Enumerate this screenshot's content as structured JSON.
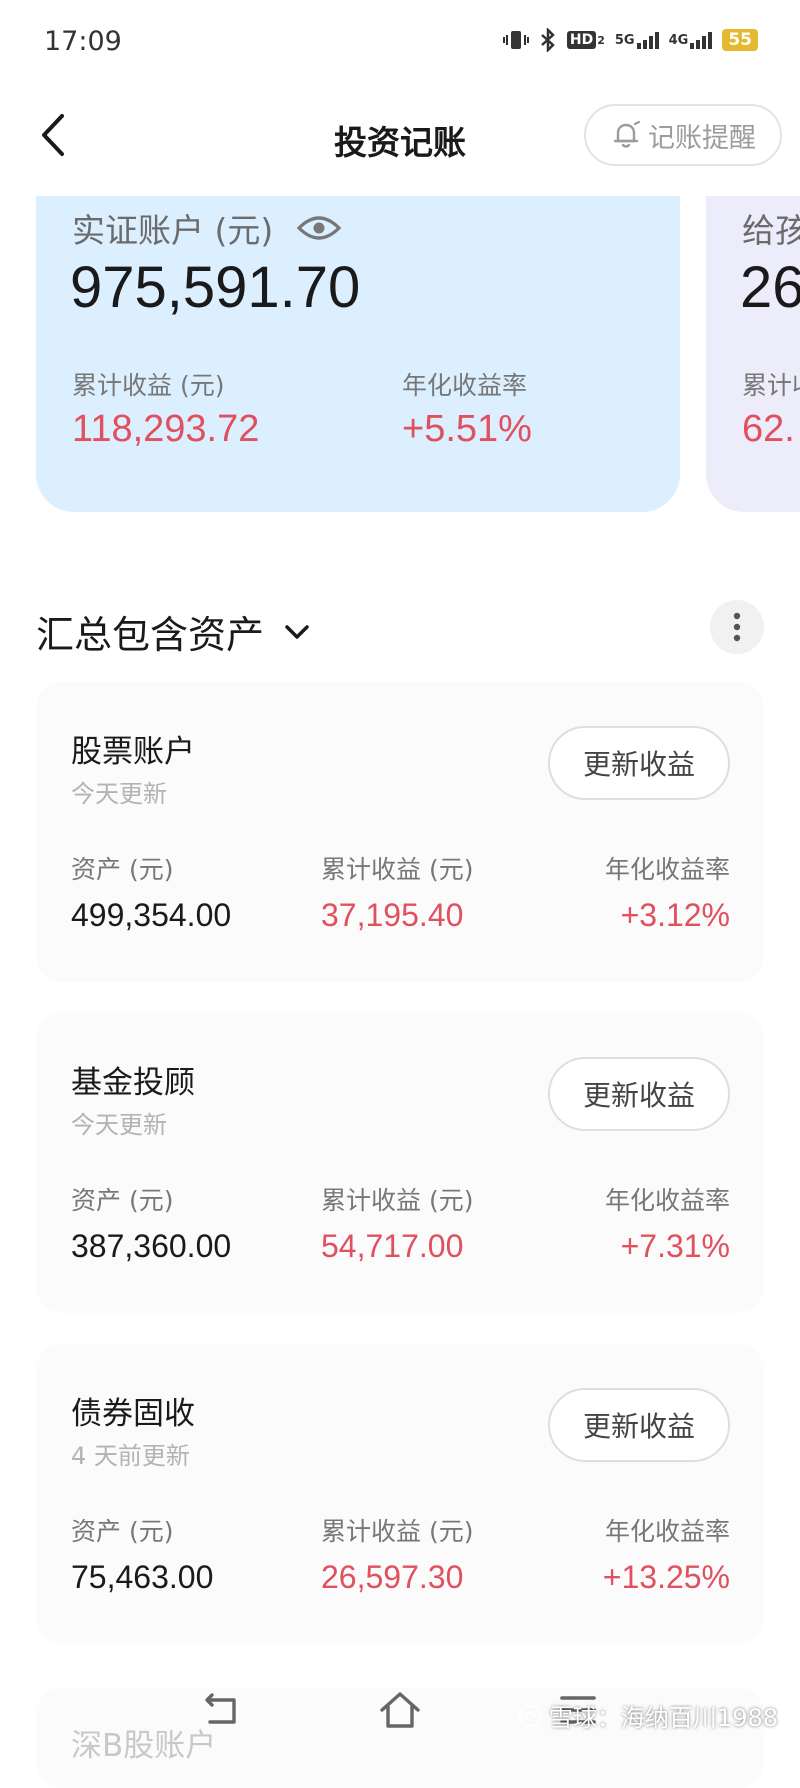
{
  "status_bar": {
    "time": "17:09",
    "icons": [
      "vibrate-icon",
      "bluetooth-icon",
      "hd-icon",
      "5g-signal-icon",
      "4g-signal-icon"
    ],
    "hd_label": "HD",
    "hd_sub": "2",
    "net1": "5G",
    "net2": "4G",
    "battery": "55"
  },
  "nav": {
    "title": "投资记账",
    "remind_label": "记账提醒"
  },
  "cards": [
    {
      "label": "实证账户 (元)",
      "value": "975,591.70",
      "profit_label": "累计收益 (元)",
      "profit_value": "118,293.72",
      "rate_label": "年化收益率",
      "rate_value": "+5.51%"
    },
    {
      "label": "给孩",
      "value": "26",
      "profit_label": "累计收",
      "profit_value": "62."
    }
  ],
  "section": {
    "title": "汇总包含资产"
  },
  "assets": [
    {
      "name": "股票账户",
      "updated": "今天更新",
      "button": "更新收益",
      "asset_label": "资产 (元)",
      "asset_value": "499,354.00",
      "profit_label": "累计收益 (元)",
      "profit_value": "37,195.40",
      "rate_label": "年化收益率",
      "rate_value": "+3.12%"
    },
    {
      "name": "基金投顾",
      "updated": "今天更新",
      "button": "更新收益",
      "asset_label": "资产 (元)",
      "asset_value": "387,360.00",
      "profit_label": "累计收益 (元)",
      "profit_value": "54,717.00",
      "rate_label": "年化收益率",
      "rate_value": "+7.31%"
    },
    {
      "name": "债券固收",
      "updated": "4 天前更新",
      "button": "更新收益",
      "asset_label": "资产 (元)",
      "asset_value": "75,463.00",
      "profit_label": "累计收益 (元)",
      "profit_value": "26,597.30",
      "rate_label": "年化收益率",
      "rate_value": "+13.25%"
    }
  ],
  "peek_asset": {
    "name": "深B股账户"
  },
  "watermark": "雪球：海纳百川1988",
  "colors": {
    "main_card_bg": "#dcefff",
    "second_card_bg": "#ececfb",
    "profit_red": "#e0505e",
    "battery": "#e5b92f"
  }
}
